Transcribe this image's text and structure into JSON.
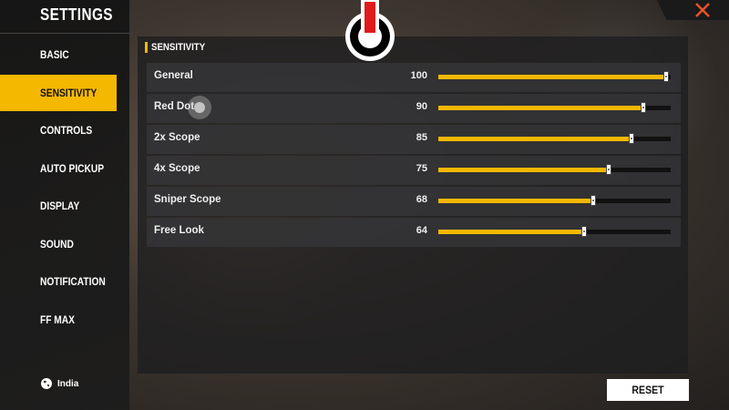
{
  "header": {
    "title": "SETTINGS"
  },
  "sidebar": {
    "items": [
      {
        "label": "BASIC",
        "active": false
      },
      {
        "label": "SENSITIVITY",
        "active": true
      },
      {
        "label": "CONTROLS",
        "active": false
      },
      {
        "label": "AUTO PICKUP",
        "active": false
      },
      {
        "label": "DISPLAY",
        "active": false
      },
      {
        "label": "SOUND",
        "active": false
      },
      {
        "label": "NOTIFICATION",
        "active": false
      },
      {
        "label": "FF MAX",
        "active": false
      }
    ],
    "region": {
      "icon": "globe-icon",
      "label": "India"
    }
  },
  "section": {
    "title": "SENSITIVITY"
  },
  "sliders": [
    {
      "label": "General",
      "value": 100
    },
    {
      "label": "Red Dot",
      "value": 90
    },
    {
      "label": "2x Scope",
      "value": 85
    },
    {
      "label": "4x Scope",
      "value": 75
    },
    {
      "label": "Sniper Scope",
      "value": 68
    },
    {
      "label": "Free Look",
      "value": 64
    }
  ],
  "slider_max": 100,
  "buttons": {
    "reset_label": "RESET"
  },
  "icons": {
    "close": "close-icon",
    "power": "power-icon"
  },
  "colors": {
    "accent": "#f5b800",
    "close": "#e8532b",
    "power_red": "#e01b1b"
  }
}
